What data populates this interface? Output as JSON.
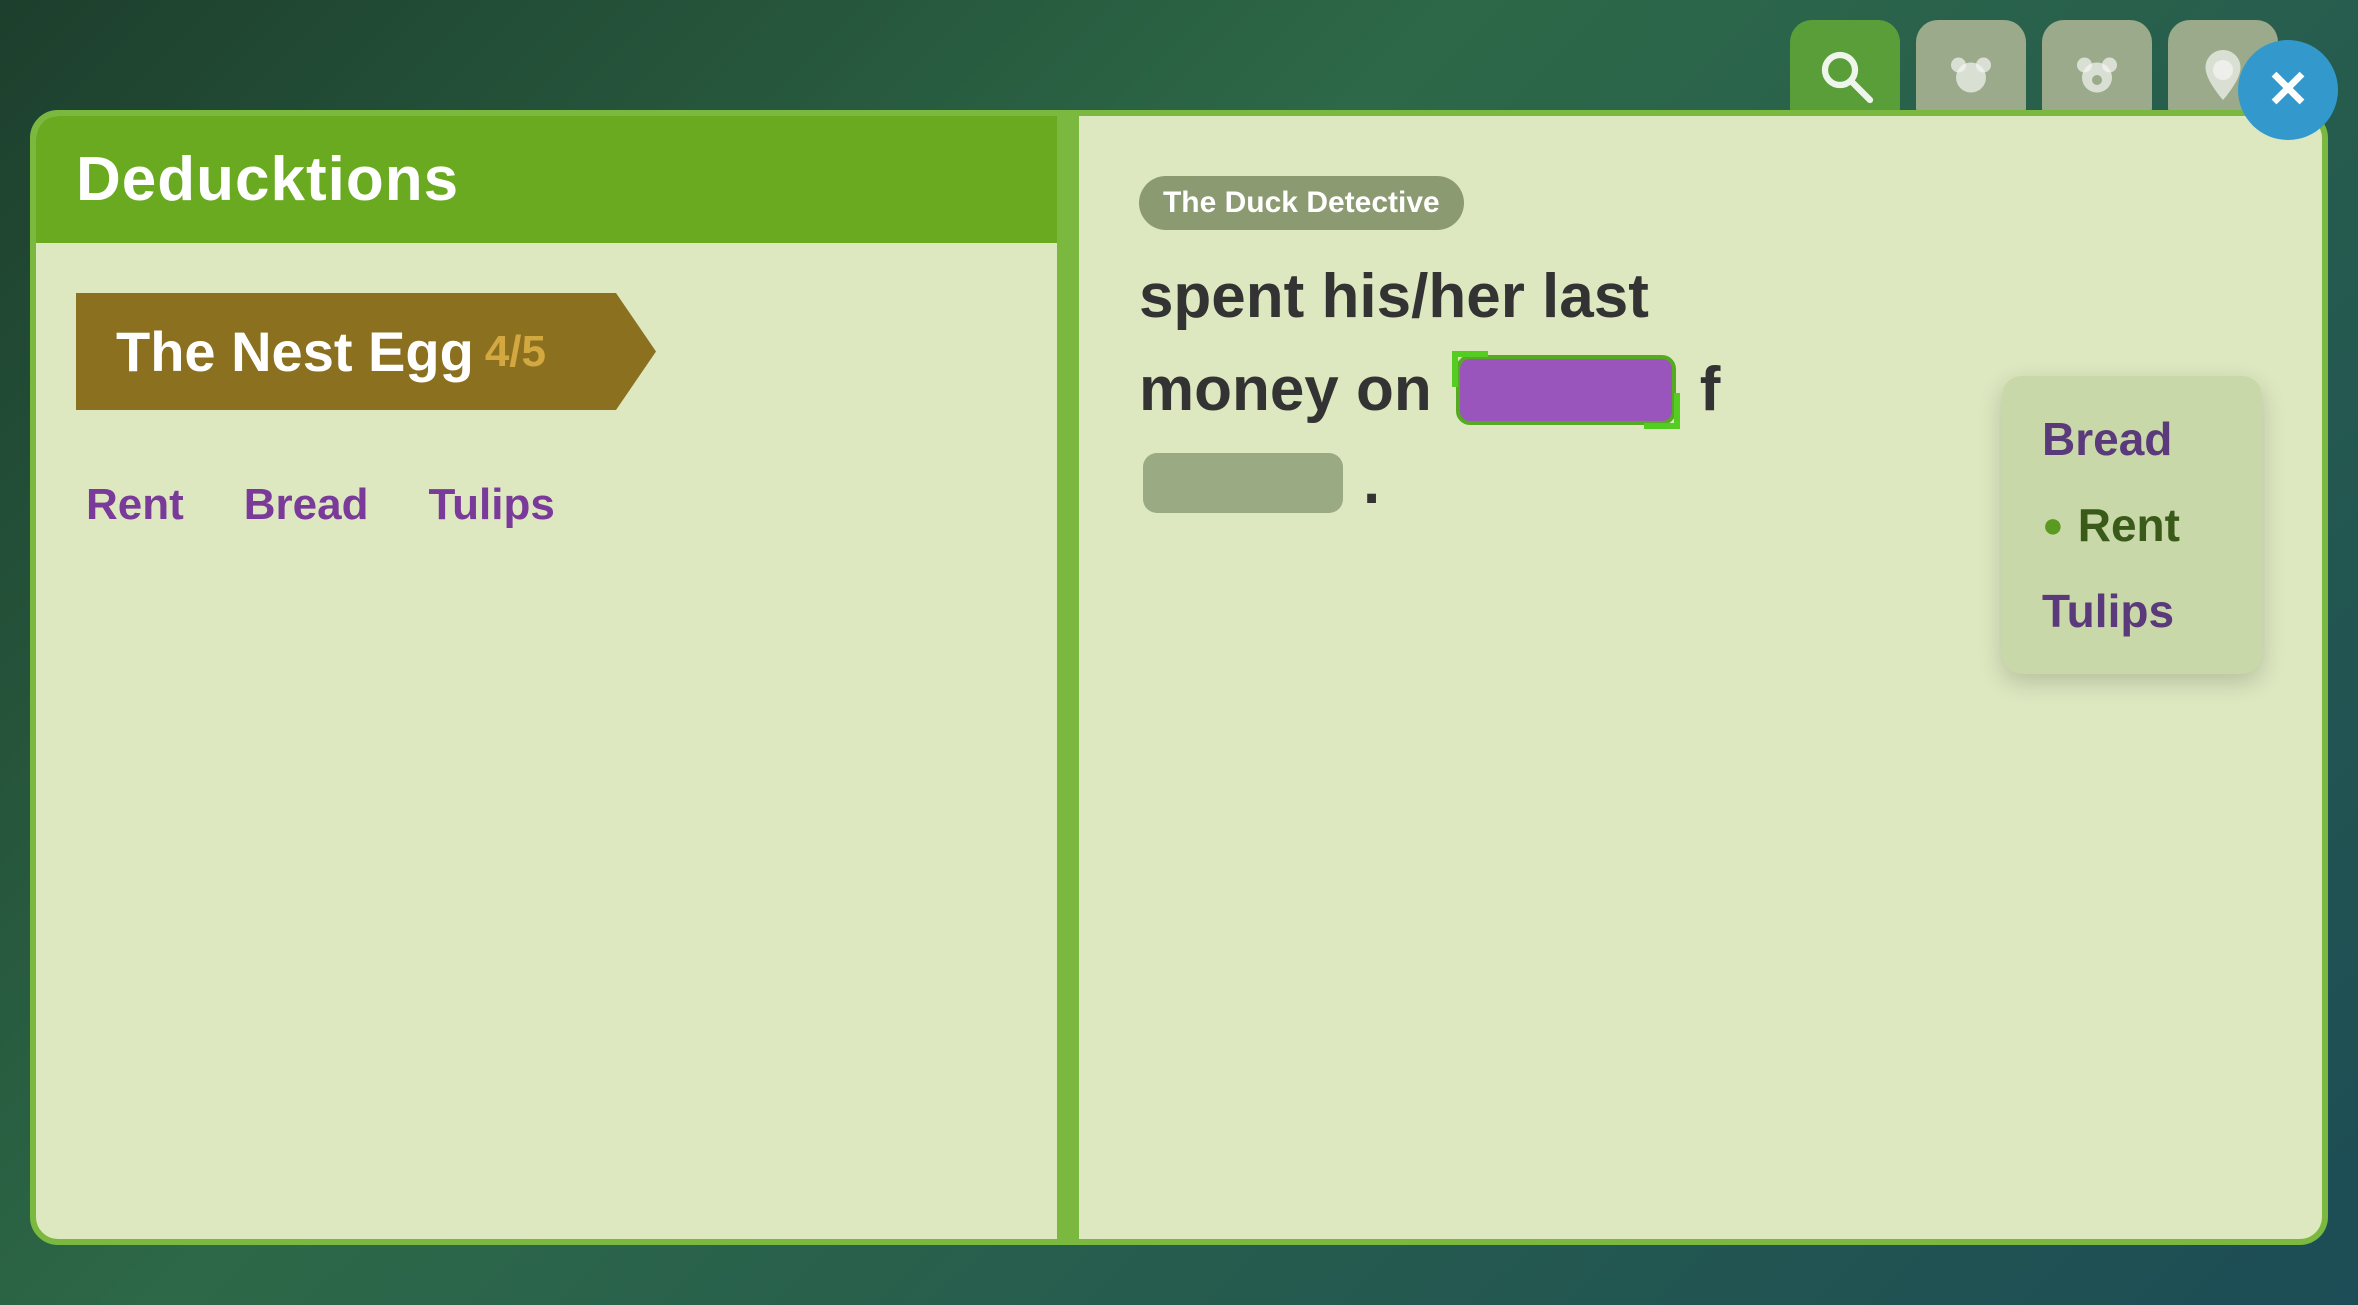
{
  "background": {
    "color": "#2d5a3d"
  },
  "top_nav": {
    "icons": [
      {
        "name": "search",
        "symbol": "🔍",
        "active": true
      },
      {
        "name": "bear",
        "symbol": "🐻",
        "active": false
      },
      {
        "name": "bear2",
        "symbol": "🐻",
        "active": false
      },
      {
        "name": "location",
        "symbol": "📍",
        "active": false
      }
    ]
  },
  "close_button": {
    "label": "✕"
  },
  "left_page": {
    "header_title": "Deducktions",
    "banner": {
      "title": "The Nest Egg",
      "count": "4/5"
    },
    "clue_tags": [
      "Rent",
      "Bread",
      "Tulips"
    ]
  },
  "right_page": {
    "detective_tag": "The Duck Detective",
    "sentence_part1": "spent his/her last",
    "sentence_part2": "money on",
    "selected_blank": "",
    "sentence_part3": "f",
    "second_blank": "",
    "sentence_end": ".",
    "dropdown": {
      "items": [
        {
          "label": "Bread",
          "selected": false
        },
        {
          "label": "Rent",
          "selected": true
        },
        {
          "label": "Tulips",
          "selected": false
        }
      ]
    }
  }
}
